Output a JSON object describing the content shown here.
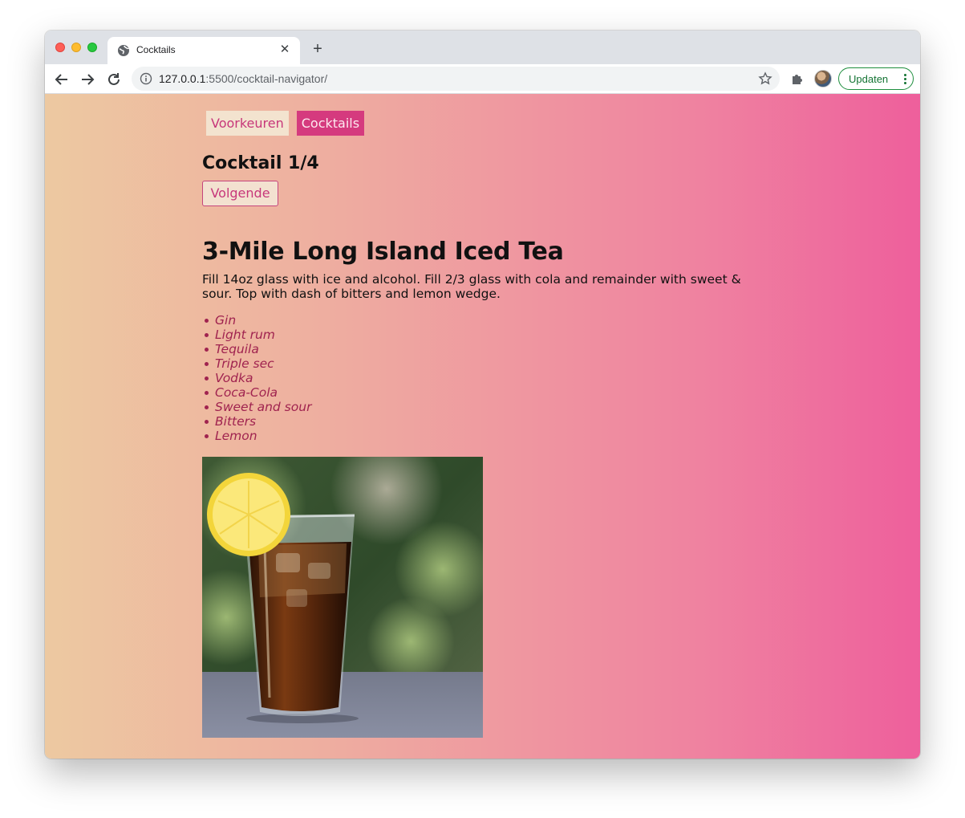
{
  "browser": {
    "tab_title": "Cocktails",
    "url_host": "127.0.0.1",
    "url_path": ":5500/cocktail-navigator/",
    "update_label": "Updaten"
  },
  "nav": {
    "preferences_label": "Voorkeuren",
    "cocktails_label": "Cocktails"
  },
  "page": {
    "counter_title": "Cocktail 1/4",
    "next_label": "Volgende"
  },
  "cocktail": {
    "name": "3-Mile Long Island Iced Tea",
    "instructions": "Fill 14oz glass with ice and alcohol. Fill 2/3 glass with cola and remainder with sweet & sour. Top with dash of bitters and lemon wedge.",
    "ingredients": [
      "Gin",
      "Light rum",
      "Tequila",
      "Triple sec",
      "Vodka",
      "Coca-Cola",
      "Sweet and sour",
      "Bitters",
      "Lemon"
    ]
  },
  "colors": {
    "gradient_start": "#edc9a1",
    "gradient_end": "#ee5f9c",
    "accent": "#d53a7e",
    "ingredient_text": "#a0234f"
  }
}
